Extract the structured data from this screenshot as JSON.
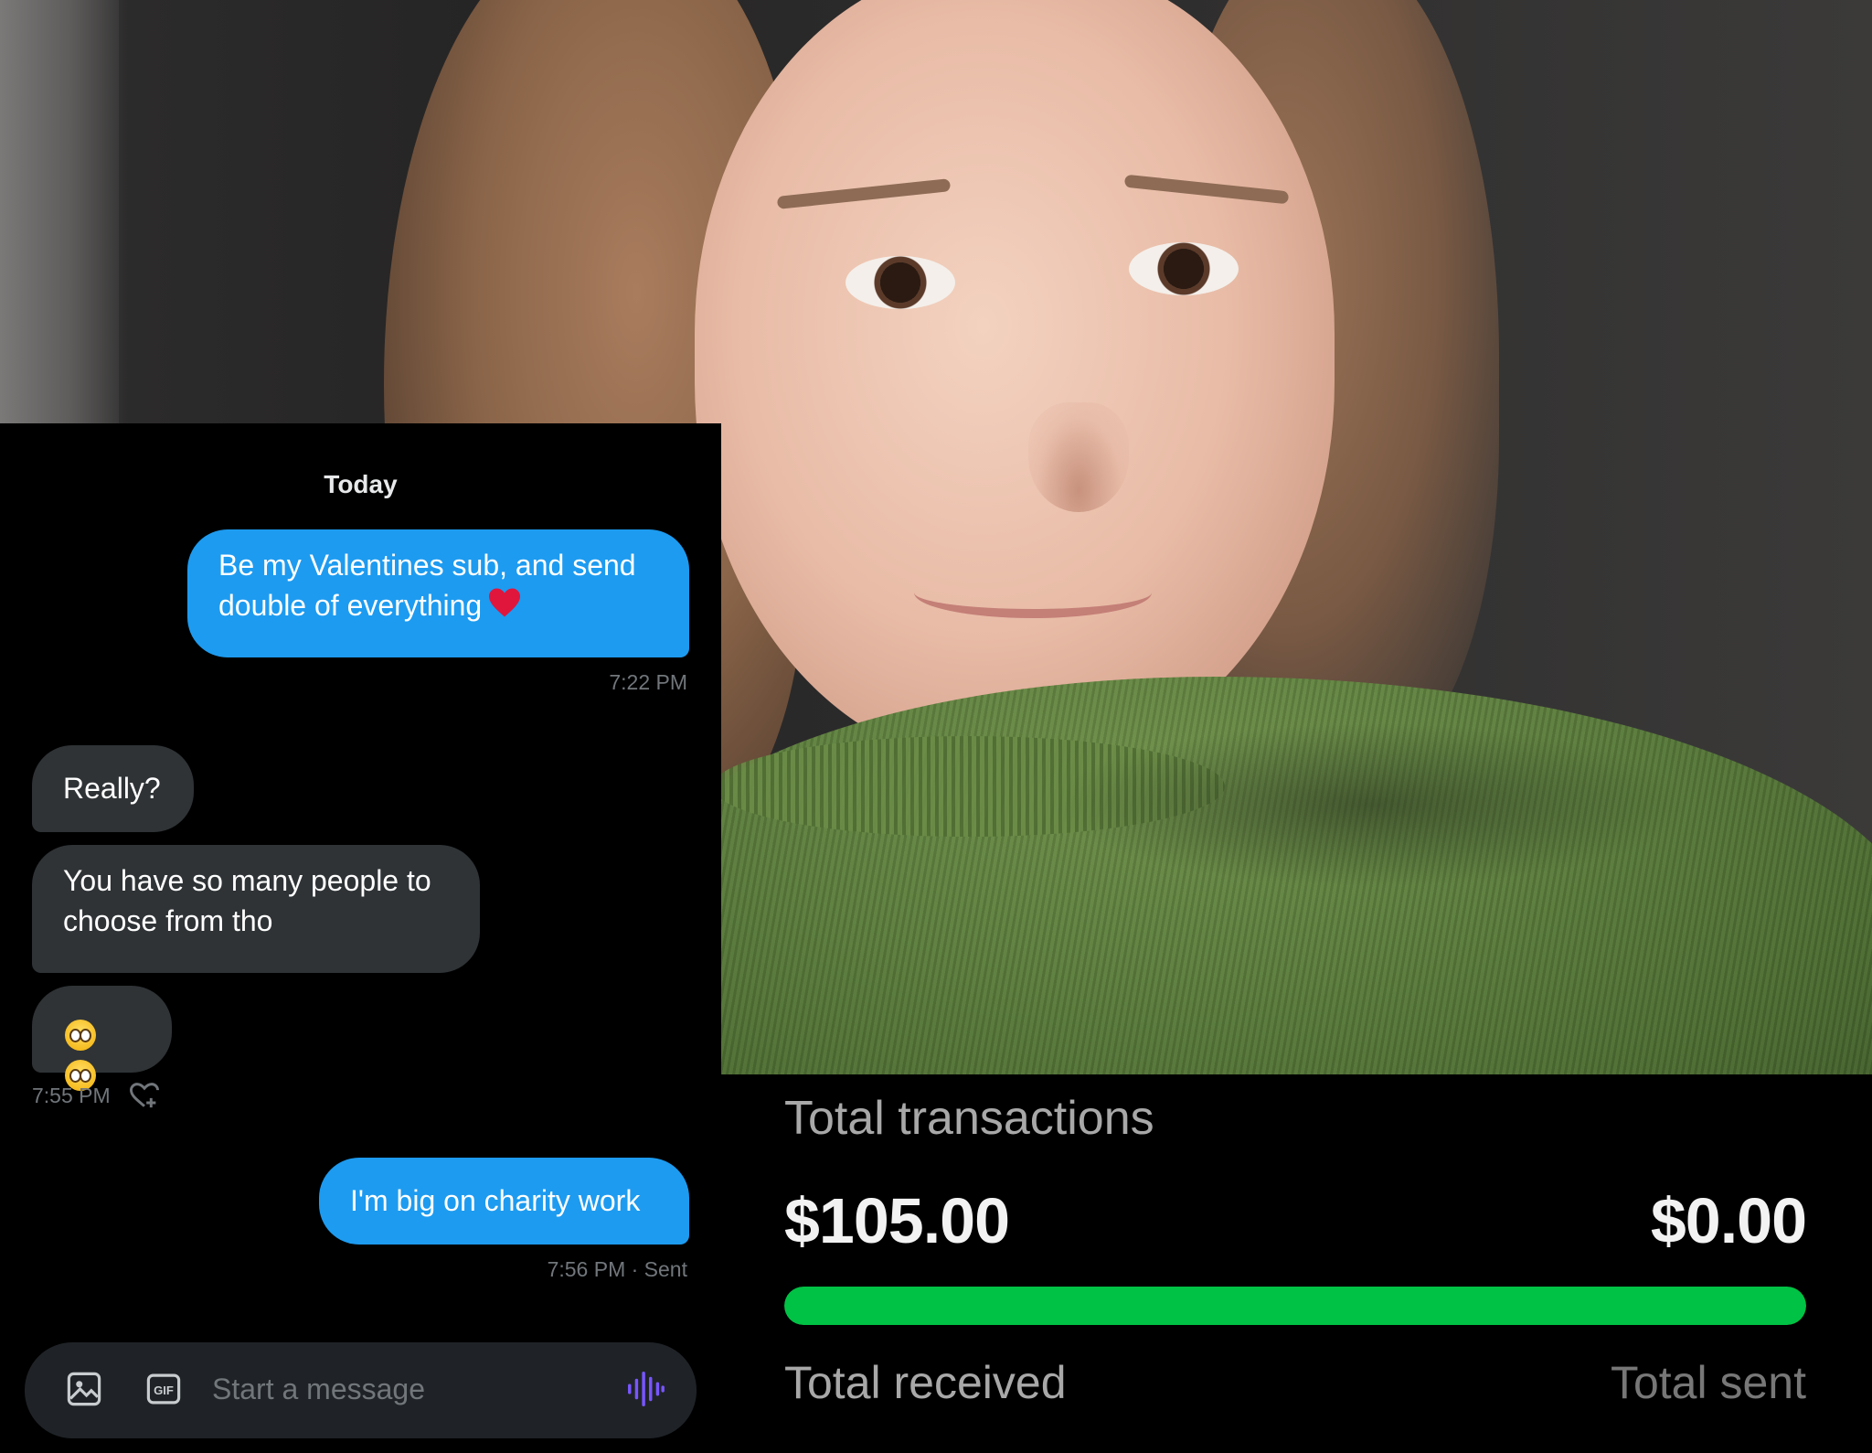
{
  "chat": {
    "date_divider": "Today",
    "messages": [
      {
        "text": "Be my Valentines sub, and send double of everything",
        "direction": "sent"
      },
      {
        "text": "Really?",
        "direction": "received"
      },
      {
        "text": "You have so many people to choose from tho",
        "direction": "received"
      },
      {
        "text": "🥹🥹",
        "direction": "received",
        "icon": "pleading-face-emoji"
      },
      {
        "text": "I'm big on charity work",
        "direction": "sent"
      }
    ],
    "message_1_line1": "Be my Valentines sub, and send",
    "message_1_line2": "double of everything",
    "message_1_time": "7:22 PM",
    "message_3_line1": "You have so many people to",
    "message_3_line2": "choose from tho",
    "received_time": "7:55 PM",
    "sent_time": "7:56 PM · Sent",
    "composer_placeholder": "Start a message",
    "composer_icons": [
      "image-icon",
      "gif-icon",
      "voice-icon"
    ],
    "gif_label": "GIF",
    "colors": {
      "sent_bubble": "#1d9bf0",
      "received_bubble": "#2f3336",
      "voice_icon": "#7856ff"
    }
  },
  "transactions": {
    "title": "Total transactions",
    "received_amount": "$105.00",
    "sent_amount": "$0.00",
    "received_label": "Total received",
    "sent_label": "Total sent",
    "received_share": 1.0,
    "bar_color": "#00c244"
  }
}
